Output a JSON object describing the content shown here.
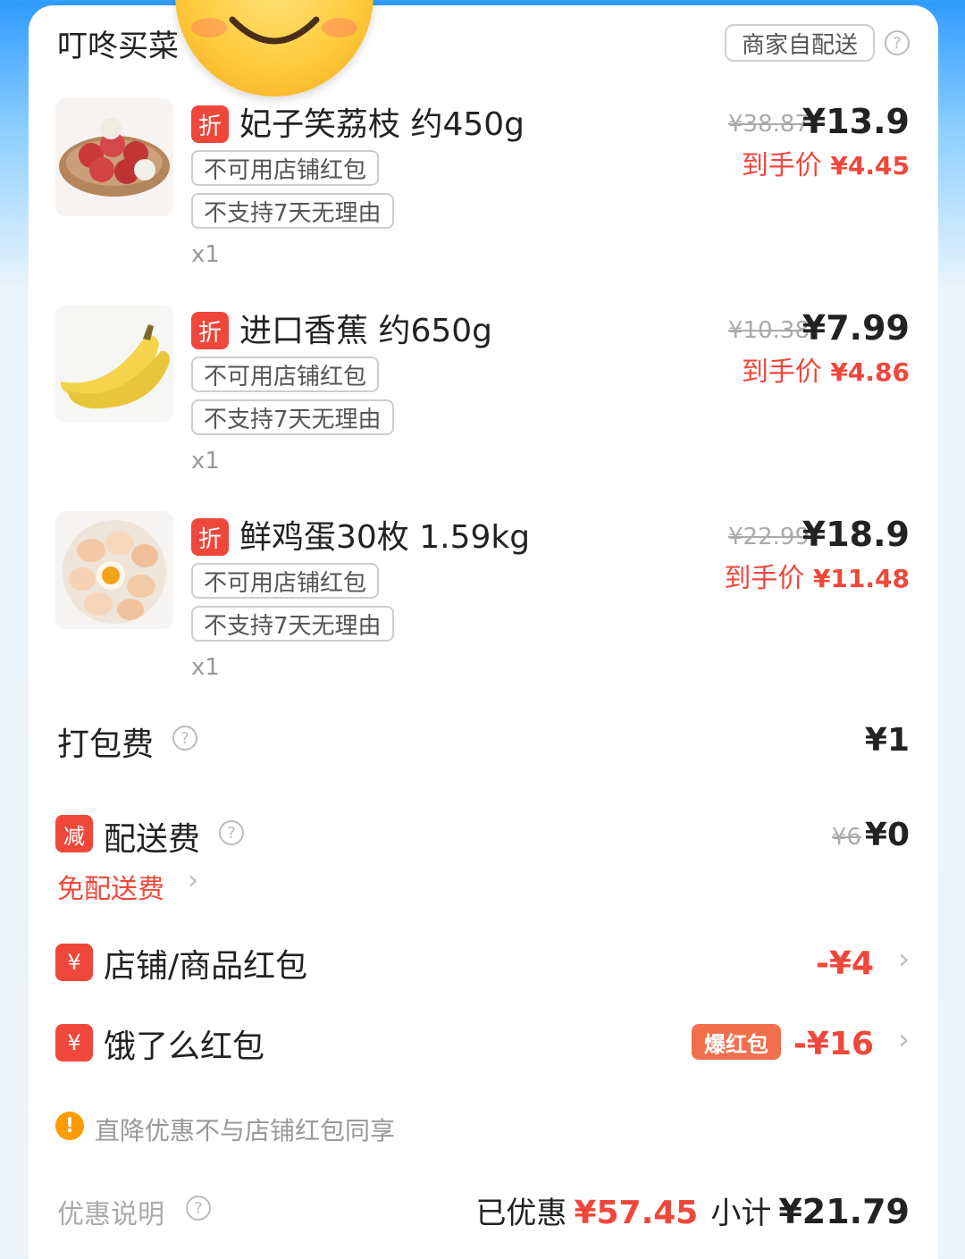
{
  "header": {
    "store_name": "叮咚买菜",
    "delivery_tag": "商家自配送",
    "help_icon": "?"
  },
  "items": [
    {
      "badge": "折",
      "name": "妃子笑荔枝 约450g",
      "tag1": "不可用店铺红包",
      "tag2": "不支持7天无理由",
      "qty": "x1",
      "original_price": "¥38.87",
      "price": "¥13.9",
      "final_label": "到手价",
      "final_price": "¥4.45",
      "image": "lychee-image"
    },
    {
      "badge": "折",
      "name": "进口香蕉 约650g",
      "tag1": "不可用店铺红包",
      "tag2": "不支持7天无理由",
      "qty": "x1",
      "original_price": "¥10.38",
      "price": "¥7.99",
      "final_label": "到手价",
      "final_price": "¥4.86",
      "image": "banana-image"
    },
    {
      "badge": "折",
      "name": "鲜鸡蛋30枚 1.59kg",
      "tag1": "不可用店铺红包",
      "tag2": "不支持7天无理由",
      "qty": "x1",
      "original_price": "¥22.99",
      "price": "¥18.9",
      "final_label": "到手价",
      "final_price": "¥11.48",
      "image": "eggs-image"
    }
  ],
  "packing_fee": {
    "label": "打包费",
    "amount": "¥1"
  },
  "delivery_fee": {
    "badge": "减",
    "label": "配送费",
    "original": "¥6",
    "amount": "¥0",
    "free_link": "免配送费"
  },
  "store_coupon": {
    "badge": "¥",
    "label": "店铺/商品红包",
    "amount": "-¥4"
  },
  "eleme_coupon": {
    "badge": "¥",
    "label": "饿了么红包",
    "boom_tag": "爆红包",
    "amount": "-¥16"
  },
  "notice": {
    "icon": "!",
    "text": "直降优惠不与店铺红包同享"
  },
  "footer": {
    "discount_info": "优惠说明",
    "saved_label": "已优惠",
    "saved_amount": "¥57.45",
    "subtotal_label": "小计",
    "subtotal_amount": "¥21.79"
  },
  "colors": {
    "accent_red": "#f0473b",
    "warning_orange": "#ff9c00",
    "top_blue": "#2f9bff"
  }
}
